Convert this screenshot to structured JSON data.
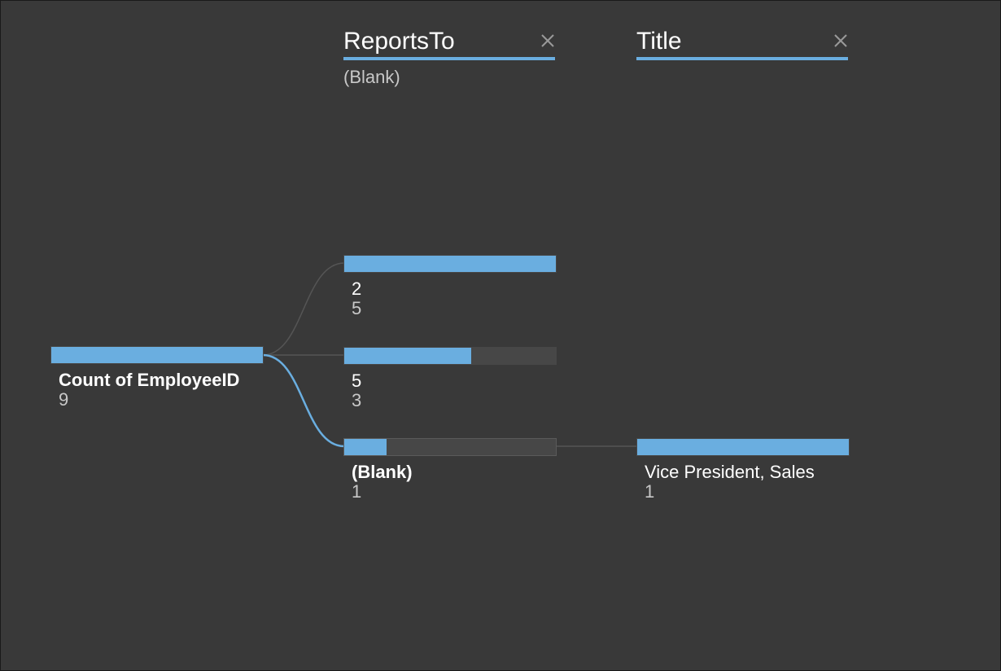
{
  "root": {
    "label": "Count of EmployeeID",
    "value": "9",
    "fill": 1.0
  },
  "levels": [
    {
      "header": "ReportsTo",
      "filter_label": "(Blank)",
      "nodes": [
        {
          "label": "2",
          "value": "5",
          "fill": 1.0
        },
        {
          "label": "5",
          "value": "3",
          "fill": 0.6
        },
        {
          "label": "(Blank)",
          "value": "1",
          "fill": 0.2,
          "selected": true
        }
      ]
    },
    {
      "header": "Title",
      "filter_label": "",
      "nodes": [
        {
          "label": "Vice President, Sales",
          "value": "1",
          "fill": 1.0
        }
      ]
    }
  ],
  "colors": {
    "background": "#393939",
    "bar_fill": "#6aaee0",
    "bar_track": "#474747",
    "connector": "#555555",
    "connector_selected": "#6aaee0",
    "text_primary": "#ffffff",
    "text_secondary": "#c8c8c8"
  },
  "icons": {
    "remove_level": "close-icon"
  }
}
